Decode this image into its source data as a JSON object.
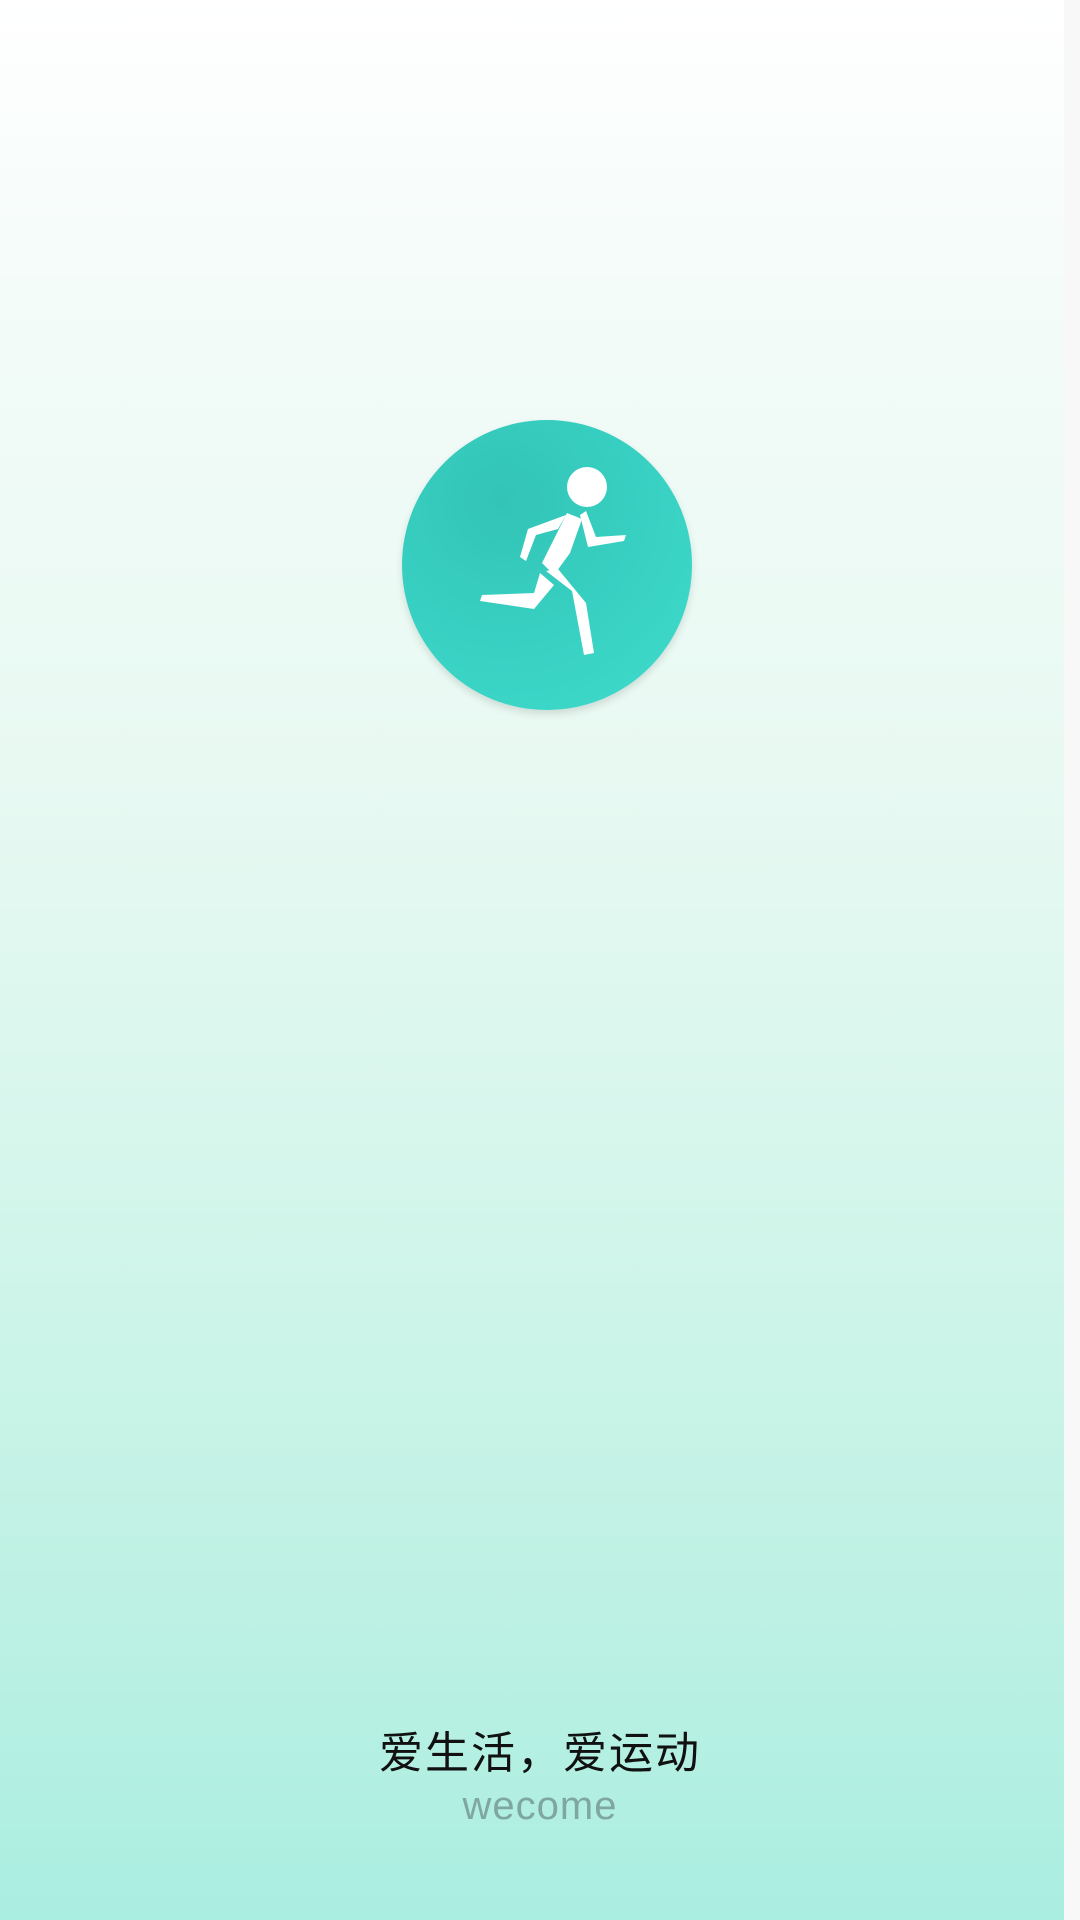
{
  "splash": {
    "logo": {
      "icon": "running-person-icon",
      "circle_color": "#3ad1c3",
      "icon_color": "#ffffff"
    },
    "tagline": "爱生活，爱运动",
    "welcome_text": "wecome"
  },
  "colors": {
    "gradient_top": "#ffffff",
    "gradient_bottom": "#aaeee1",
    "tagline_color": "#111111",
    "welcome_color": "#7fa79f"
  }
}
